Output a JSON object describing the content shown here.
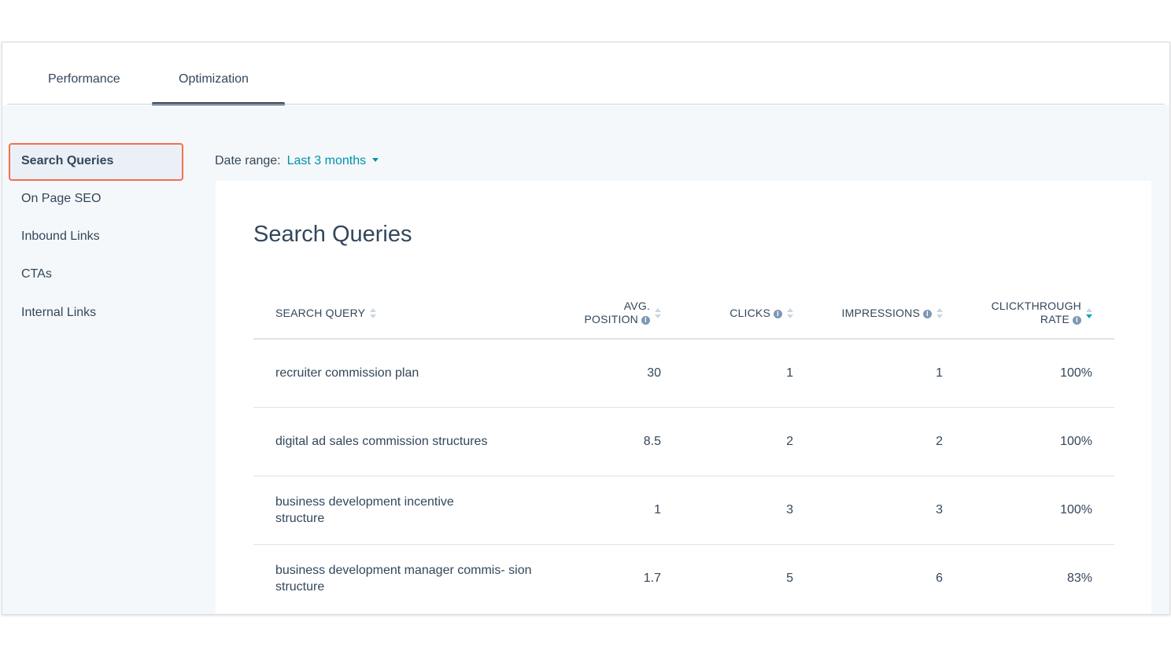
{
  "tabs": [
    {
      "label": "Performance"
    },
    {
      "label": "Optimization"
    }
  ],
  "sidebar": {
    "items": [
      {
        "label": "Search Queries"
      },
      {
        "label": "On Page SEO"
      },
      {
        "label": "Inbound Links"
      },
      {
        "label": "CTAs"
      },
      {
        "label": "Internal Links"
      }
    ]
  },
  "filters": {
    "date_range_label": "Date range:",
    "date_range_value": "Last 3 months"
  },
  "card": {
    "title": "Search Queries"
  },
  "table": {
    "columns": [
      {
        "line1": "Search Query",
        "line2": ""
      },
      {
        "line1": "Avg.",
        "line2": "Position"
      },
      {
        "line1": "Clicks",
        "line2": ""
      },
      {
        "line1": "Impressions",
        "line2": ""
      },
      {
        "line1": "Clickthrough",
        "line2": "Rate"
      }
    ],
    "rows": [
      {
        "query": "recruiter commission plan",
        "position": "30",
        "clicks": "1",
        "impressions": "1",
        "ctr": "100%"
      },
      {
        "query": "digital ad sales commission structures",
        "position": "8.5",
        "clicks": "2",
        "impressions": "2",
        "ctr": "100%"
      },
      {
        "query": "business development incentive structure",
        "position": "1",
        "clicks": "3",
        "impressions": "3",
        "ctr": "100%"
      },
      {
        "query": "business development manager commis- sion structure",
        "position": "1.7",
        "clicks": "5",
        "impressions": "6",
        "ctr": "83%"
      }
    ],
    "sorted_column": "Clickthrough Rate",
    "sort_direction": "descending"
  },
  "colors": {
    "accent": "#0091ae",
    "highlight_border": "#f2704e",
    "text": "#33475b",
    "panel_bg": "#f5f8fa"
  }
}
